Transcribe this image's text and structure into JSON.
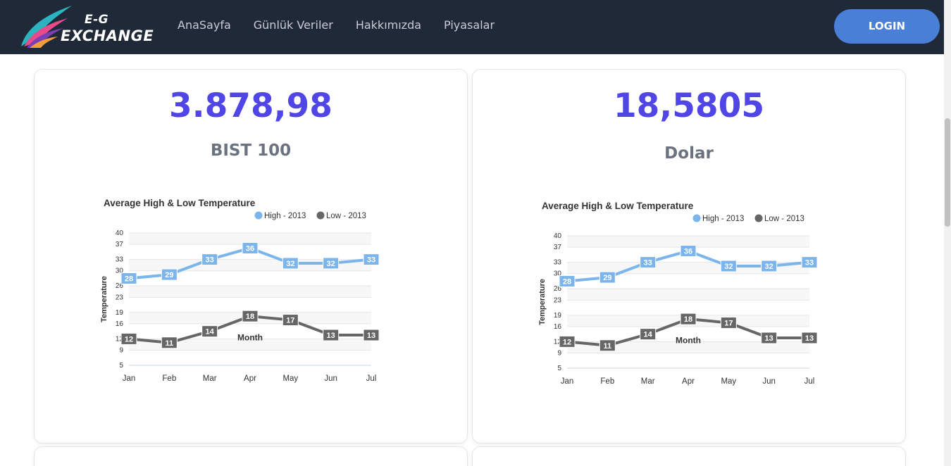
{
  "header": {
    "logo_top": "E-G",
    "logo_bottom": "EXCHANGE",
    "nav": [
      "AnaSayfa",
      "Günlük Veriler",
      "Hakkımızda",
      "Piyasalar"
    ],
    "login_label": "LOGIN"
  },
  "cards": [
    {
      "value": "3.878,98",
      "label": "BIST 100"
    },
    {
      "value": "18,5805",
      "label": "Dolar"
    }
  ],
  "colors": {
    "accent": "#4f46e5",
    "high": "#7cb5ec",
    "low": "#666666",
    "nav_bg": "#1f2937",
    "login_bg": "#4a7fd8"
  },
  "chart_data": [
    {
      "type": "line",
      "title": "Average High & Low Temperature",
      "xlabel": "Month",
      "ylabel": "Temperature",
      "categories": [
        "Jan",
        "Feb",
        "Mar",
        "Apr",
        "May",
        "Jun",
        "Jul"
      ],
      "y_ticks": [
        40,
        37,
        33,
        30,
        26,
        23,
        19,
        16,
        12,
        9,
        5
      ],
      "ylim": [
        5,
        40
      ],
      "legend": "top-right",
      "series": [
        {
          "name": "High - 2013",
          "values": [
            28,
            29,
            33,
            36,
            32,
            32,
            33
          ],
          "color": "#7cb5ec"
        },
        {
          "name": "Low - 2013",
          "values": [
            12,
            11,
            14,
            18,
            17,
            13,
            13
          ],
          "color": "#666666"
        }
      ]
    },
    {
      "type": "line",
      "title": "Average High & Low Temperature",
      "xlabel": "Month",
      "ylabel": "Temperature",
      "categories": [
        "Jan",
        "Feb",
        "Mar",
        "Apr",
        "May",
        "Jun",
        "Jul"
      ],
      "y_ticks": [
        40,
        37,
        33,
        30,
        26,
        23,
        19,
        16,
        12,
        9,
        5
      ],
      "ylim": [
        5,
        40
      ],
      "legend": "top-right",
      "series": [
        {
          "name": "High - 2013",
          "values": [
            28,
            29,
            33,
            36,
            32,
            32,
            33
          ],
          "color": "#7cb5ec"
        },
        {
          "name": "Low - 2013",
          "values": [
            12,
            11,
            14,
            18,
            17,
            13,
            13
          ],
          "color": "#666666"
        }
      ]
    }
  ]
}
